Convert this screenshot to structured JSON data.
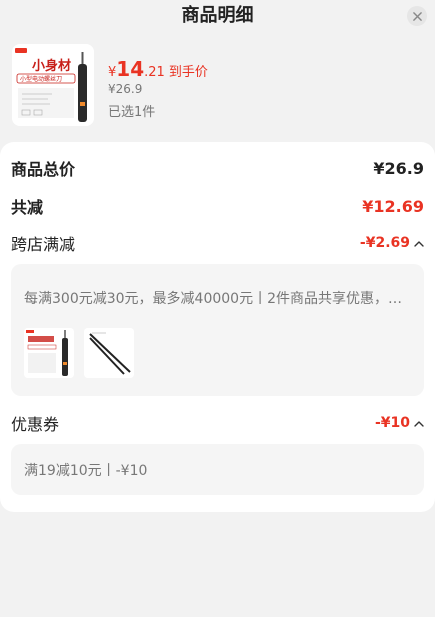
{
  "header": {
    "title": "商品明细"
  },
  "product": {
    "price_yen": "¥",
    "price_int": "14",
    "price_dec": ".21",
    "price_tag": "到手价",
    "original_price": "¥26.9",
    "selected_qty": "已选1件",
    "thumb_brand": "小身材",
    "thumb_subtitle": "小型电动螺丝刀"
  },
  "summary": {
    "total_label": "商品总价",
    "total_value": "¥26.9",
    "discount_label": "共减",
    "discount_value": "¥12.69",
    "cross_store_label": "跨店满减",
    "cross_store_value": "-¥2.69",
    "cross_store_desc": "每满300元减30元，最多减40000元丨2件商品共享优惠，…",
    "coupon_label": "优惠券",
    "coupon_value": "-¥10",
    "coupon_desc": "满19减10元丨-¥10"
  },
  "colors": {
    "accent": "#e93323",
    "card_bg": "#ffffff",
    "page_bg": "#f2f2f2"
  },
  "icons": {
    "close": "close-icon",
    "collapse": "chevron-up-icon"
  }
}
